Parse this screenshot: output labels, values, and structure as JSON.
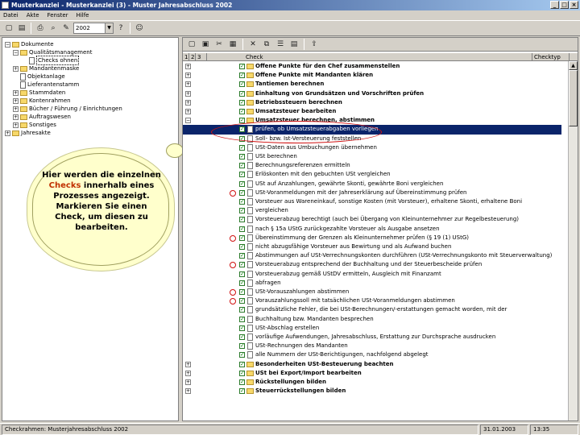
{
  "window": {
    "title": "Musterkanzlei - Musterkanzlei (3) - Muster Jahresabschluss 2002"
  },
  "menu": [
    "Datei",
    "Akte",
    "Fenster",
    "Hilfe"
  ],
  "toolbar": {
    "year": "2002"
  },
  "tree": [
    {
      "label": "Dokumente",
      "level": 0,
      "expanded": true
    },
    {
      "label": "Qualitätsmanagement",
      "level": 1,
      "expanded": true
    },
    {
      "label": "Checks ohnen",
      "level": 2
    },
    {
      "label": "Mandantenmaske",
      "level": 1
    },
    {
      "label": "Objektanlage",
      "level": 1
    },
    {
      "label": "Lieferantenstamm",
      "level": 1
    },
    {
      "label": "Stammdaten",
      "level": 1
    },
    {
      "label": "Kontenrahmen",
      "level": 1
    },
    {
      "label": "Bücher / Führung / Einrichtungen",
      "level": 1
    },
    {
      "label": "Auftragswesen",
      "level": 1
    },
    {
      "label": "Sonstiges",
      "level": 1
    },
    {
      "label": "Jahresakte",
      "level": 0
    }
  ],
  "callout": {
    "text_before": "Hier werden die einzelnen ",
    "highlight": "Checks",
    "text_after": " innerhalb eines Prozesses angezeigt. Markieren Sie einen Check, um diesen zu bearbeiten."
  },
  "grid": {
    "columns": [
      "1",
      "2",
      "3",
      "Check",
      "Checktyp"
    ],
    "rows": [
      {
        "text": "Offene Punkte für den Chef zusammenstellen",
        "bold": true,
        "folder": true
      },
      {
        "text": "Offene Punkte mit Mandanten klären",
        "bold": true,
        "folder": true
      },
      {
        "text": "Tantiemen berechnen",
        "bold": true,
        "folder": true
      },
      {
        "text": "Einhaltung von Grundsätzen und Vorschriften prüfen",
        "bold": true,
        "folder": true
      },
      {
        "text": "Betriebssteuern berechnen",
        "bold": true,
        "folder": true
      },
      {
        "text": "Umsatzsteuer bearbeiten",
        "bold": true,
        "folder": true
      },
      {
        "text": "Umsatzsteuer berechnen, abstimmen",
        "bold": true,
        "folder": true,
        "expanded": true
      },
      {
        "text": "prüfen, ob Umsatzsteuerabgaben vorliegen",
        "selected": true
      },
      {
        "text": "Soll- bzw. Ist-Versteuerung feststellen"
      },
      {
        "text": "USt-Daten aus Umbuchungen übernehmen"
      },
      {
        "text": "USt berechnen"
      },
      {
        "text": "Berechnungsreferenzen ermitteln"
      },
      {
        "text": "Erlöskonten mit den gebuchten USt vergleichen"
      },
      {
        "text": "USt auf Anzahlungen, gewährte Skonti, gewährte Boni vergleichen"
      },
      {
        "text": "USt-Voranmeldungen mit der Jahreserklärung auf Übereinstimmung prüfen",
        "marked": true
      },
      {
        "text": "Vorsteuer aus Wareneinkauf, sonstige Kosten (mit Vorsteuer), erhaltene Skonti, erhaltene Boni"
      },
      {
        "text": "vergleichen"
      },
      {
        "text": "Vorsteuerabzug berechtigt (auch bei Übergang von Kleinunternehmer zur Regelbesteuerung)"
      },
      {
        "text": "nach § 15a UStG zurückgezahlte Vorsteuer als Ausgabe ansetzen"
      },
      {
        "text": "Übereinstimmung der Grenzen als Kleinunternehmer prüfen (§ 19 (1) UStG)",
        "marked": true
      },
      {
        "text": "nicht abzugsfähige Vorsteuer aus Bewirtung und als Aufwand buchen"
      },
      {
        "text": "Abstimmungen auf USt-Verrechnungskonten durchführen (USt-Verrechnungskonto mit Steuerverwaltung)"
      },
      {
        "text": "Vorsteuerabzug entsprechend der Buchhaltung und der Steuerbescheide prüfen",
        "marked": true
      },
      {
        "text": "Vorsteuerabzug gemäß UStDV ermitteln, Ausgleich mit Finanzamt"
      },
      {
        "text": "abfragen"
      },
      {
        "text": "USt-Vorauszahlungen abstimmen",
        "marked": true
      },
      {
        "text": "Vorauszahlungssoll mit tatsächlichen USt-Voranmeldungen abstimmen",
        "marked": true
      },
      {
        "text": "grundsätzliche Fehler, die bei USt-Berechnungen/-erstattungen gemacht worden, mit der"
      },
      {
        "text": "Buchhaltung bzw. Mandanten besprechen"
      },
      {
        "text": "USt-Abschlag erstellen"
      },
      {
        "text": "vorläufige Aufwendungen, Jahresabschluss, Erstattung zur Durchsprache ausdrucken"
      },
      {
        "text": "USt-Rechnungen des Mandanten"
      },
      {
        "text": "alle Nummern der USt-Berichtigungen, nachfolgend abgelegt"
      },
      {
        "text": "Besonderheiten USt-Besteuerung beachten",
        "bold": true,
        "folder": true
      },
      {
        "text": "USt bei Export/Import bearbeiten",
        "bold": true,
        "folder": true
      },
      {
        "text": "Rückstellungen bilden",
        "bold": true,
        "folder": true
      },
      {
        "text": "Steuerrückstellungen bilden",
        "bold": true,
        "folder": true
      }
    ]
  },
  "status": {
    "left": "Checkrahmen: Musterjahresabschluss 2002",
    "date": "31.01.2003",
    "time": "13:35"
  }
}
